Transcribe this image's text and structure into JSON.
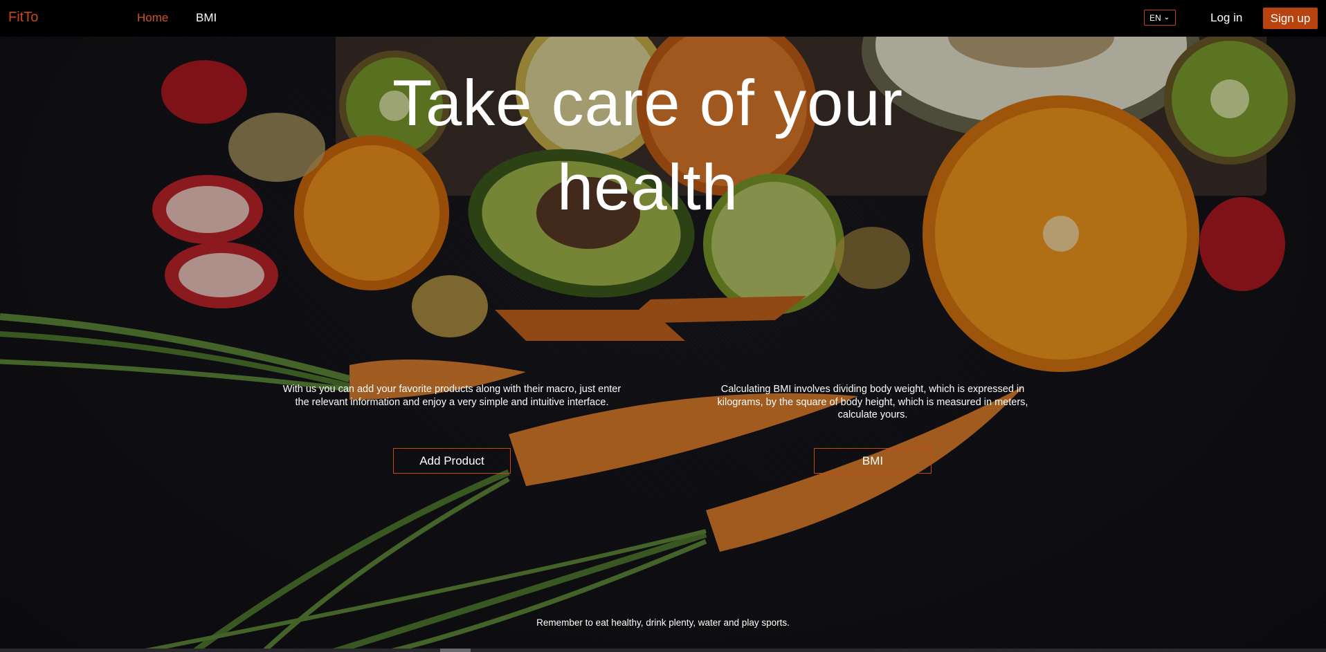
{
  "navbar": {
    "brand": "FitTo",
    "links": [
      {
        "label": "Home",
        "active": true
      },
      {
        "label": "BMI",
        "active": false
      }
    ],
    "language": "EN",
    "login_label": "Log in",
    "signup_label": "Sign up"
  },
  "hero": {
    "headline_line1": "Take care of your",
    "headline_line2": "health"
  },
  "features": [
    {
      "description": "With us you can add your favorite products along with their macro, just enter the relevant information and enjoy a very simple and intuitive interface.",
      "button_label": "Add Product"
    },
    {
      "description": "Calculating BMI involves dividing body weight, which is expressed in kilograms, by the square of body height, which is measured in meters, calculate yours.",
      "button_label": "BMI"
    }
  ],
  "footer": {
    "note": "Remember to eat healthy, drink plenty, water and play sports."
  },
  "colors": {
    "accent": "#c8481a",
    "signup_bg": "#b8430f",
    "navbar_bg": "#000000"
  }
}
